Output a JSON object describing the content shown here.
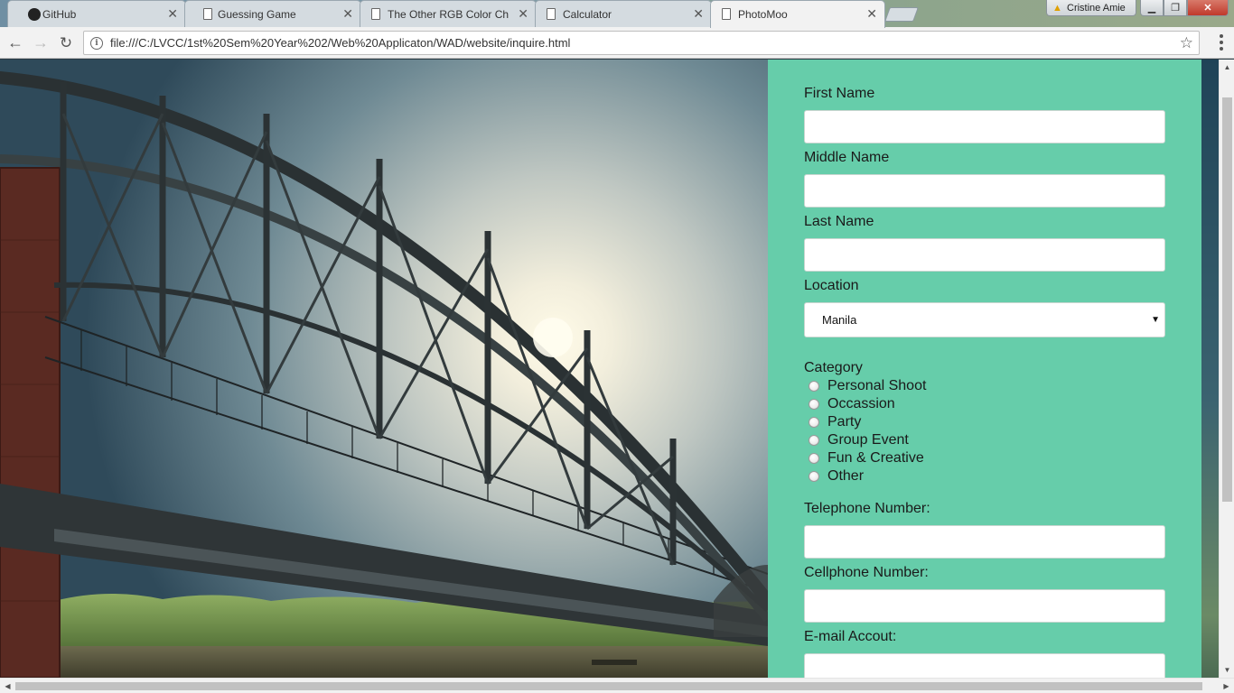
{
  "browser": {
    "tabs": [
      {
        "title": "GitHub"
      },
      {
        "title": "Guessing Game"
      },
      {
        "title": "The Other RGB Color Ch"
      },
      {
        "title": "Calculator"
      },
      {
        "title": "PhotoMoo"
      }
    ],
    "active_tab": 4,
    "profile_name": "Cristine Amie",
    "url": "file:///C:/LVCC/1st%20Sem%20Year%202/Web%20Applicaton/WAD/website/inquire.html",
    "icons": {
      "back": "arrow-left-icon",
      "forward": "arrow-right-icon",
      "reload": "reload-icon",
      "info": "info-icon",
      "bookmark": "star-icon",
      "menu": "kebab-menu-icon"
    }
  },
  "page": {
    "hero_image": "bridge-photo",
    "form": {
      "first_name": {
        "label": "First Name",
        "value": ""
      },
      "middle_name": {
        "label": "Middle Name",
        "value": ""
      },
      "last_name": {
        "label": "Last Name",
        "value": ""
      },
      "location": {
        "label": "Location",
        "selected": "Manila"
      },
      "category": {
        "label": "Category",
        "options": [
          "Personal Shoot",
          "Occassion",
          "Party",
          "Group Event",
          "Fun & Creative",
          "Other"
        ],
        "selected": null
      },
      "telephone": {
        "label": "Telephone Number:",
        "value": ""
      },
      "cellphone": {
        "label": "Cellphone Number:",
        "value": ""
      },
      "email": {
        "label": "E-mail Accout:",
        "value": ""
      }
    },
    "colors": {
      "form_background": "#66cdaa",
      "input_background": "#ffffff"
    }
  }
}
